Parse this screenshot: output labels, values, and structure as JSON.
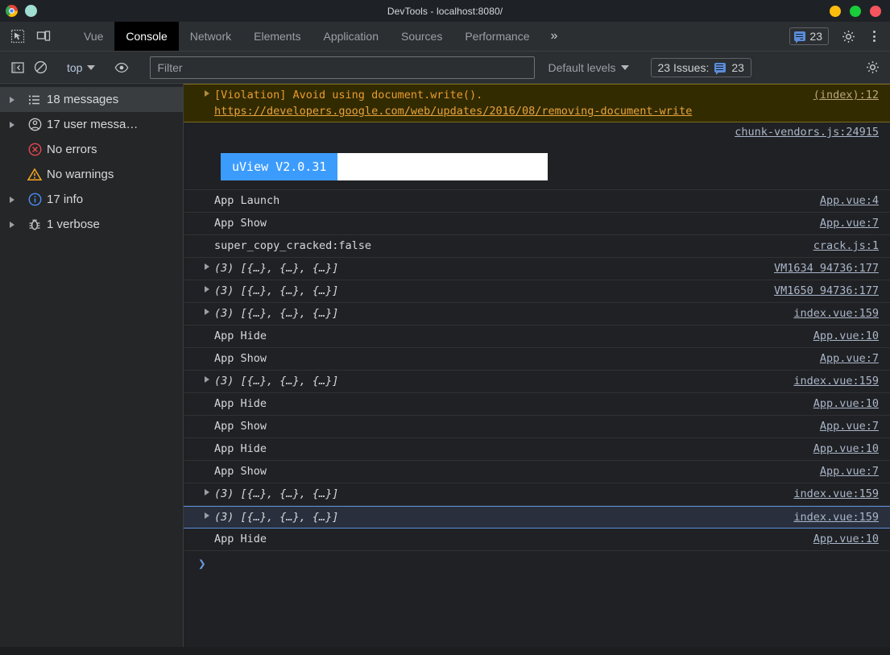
{
  "window": {
    "title": "DevTools - localhost:8080/",
    "logo_icon": "chrome-logo-icon",
    "profile_icon": "profile-avatar-icon",
    "minimize_label": "",
    "maximize_label": "",
    "close_label": ""
  },
  "tabbar": {
    "inspect_icon": "inspect-element-icon",
    "device_icon": "device-toolbar-icon",
    "tabs": [
      {
        "label": "Vue",
        "active": false
      },
      {
        "label": "Console",
        "active": true
      },
      {
        "label": "Network",
        "active": false
      },
      {
        "label": "Elements",
        "active": false
      },
      {
        "label": "Application",
        "active": false
      },
      {
        "label": "Sources",
        "active": false
      },
      {
        "label": "Performance",
        "active": false
      }
    ],
    "more_tabs_label": "»",
    "issues_count": "23",
    "issues_icon": "issues-bubble-icon",
    "settings_icon": "gear-icon",
    "menu_icon": "kebab-menu-icon"
  },
  "console_toolbar": {
    "sidebar_toggle_icon": "console-sidebar-toggle-icon",
    "clear_icon": "clear-console-icon",
    "context_label": "top",
    "context_caret_icon": "chevron-down-icon",
    "eye_icon": "live-expression-eye-icon",
    "filter_placeholder": "Filter",
    "filter_value": "",
    "levels_label": "Default levels",
    "levels_caret_icon": "chevron-down-icon",
    "issues_label": "23 Issues:",
    "issues_count": "23",
    "issues_icon": "issues-bubble-icon",
    "settings_icon": "gear-icon"
  },
  "sidebar": {
    "items": [
      {
        "label": "18 messages",
        "icon": "list-messages-icon",
        "expandable": true,
        "selected": true
      },
      {
        "label": "17 user messa…",
        "icon": "user-message-icon",
        "expandable": true,
        "selected": false
      },
      {
        "label": "No errors",
        "icon": "error-circle-icon",
        "expandable": false,
        "selected": false
      },
      {
        "label": "No warnings",
        "icon": "warning-triangle-icon",
        "expandable": false,
        "selected": false
      },
      {
        "label": "17 info",
        "icon": "info-circle-icon",
        "expandable": true,
        "selected": false
      },
      {
        "label": "1 verbose",
        "icon": "bug-verbose-icon",
        "expandable": true,
        "selected": false
      }
    ]
  },
  "console": {
    "violation": {
      "kind": "warning",
      "expand_icon": "disclosure-triangle-icon",
      "prefix": "[Violation] Avoid using document.write(). ",
      "link_text": "https://developers.google.com/web/updates/2016/08/removing-document-write",
      "source": "(index):12"
    },
    "uview": {
      "source": "chunk-vendors.js:24915",
      "badge_label": "uView V2.0.31",
      "badge_bg": "#3c9cfe",
      "badge_fg": "#ffffff",
      "panel_bg": "#ffffff"
    },
    "rows": [
      {
        "text": "App Launch",
        "source": "App.vue:4",
        "expandable": false,
        "italic": false,
        "selected": false
      },
      {
        "text": "App Show",
        "source": "App.vue:7",
        "expandable": false,
        "italic": false,
        "selected": false
      },
      {
        "text": "super_copy_cracked:false",
        "source": "crack.js:1",
        "expandable": false,
        "italic": false,
        "selected": false
      },
      {
        "text": "(3) [{…}, {…}, {…}]",
        "source": "VM1634 94736:177",
        "expandable": true,
        "italic": true,
        "selected": false
      },
      {
        "text": "(3) [{…}, {…}, {…}]",
        "source": "VM1650 94736:177",
        "expandable": true,
        "italic": true,
        "selected": false
      },
      {
        "text": "(3) [{…}, {…}, {…}]",
        "source": "index.vue:159",
        "expandable": true,
        "italic": true,
        "selected": false
      },
      {
        "text": "App Hide",
        "source": "App.vue:10",
        "expandable": false,
        "italic": false,
        "selected": false
      },
      {
        "text": "App Show",
        "source": "App.vue:7",
        "expandable": false,
        "italic": false,
        "selected": false
      },
      {
        "text": "(3) [{…}, {…}, {…}]",
        "source": "index.vue:159",
        "expandable": true,
        "italic": true,
        "selected": false
      },
      {
        "text": "App Hide",
        "source": "App.vue:10",
        "expandable": false,
        "italic": false,
        "selected": false
      },
      {
        "text": "App Show",
        "source": "App.vue:7",
        "expandable": false,
        "italic": false,
        "selected": false
      },
      {
        "text": "App Hide",
        "source": "App.vue:10",
        "expandable": false,
        "italic": false,
        "selected": false
      },
      {
        "text": "App Show",
        "source": "App.vue:7",
        "expandable": false,
        "italic": false,
        "selected": false
      },
      {
        "text": "(3) [{…}, {…}, {…}]",
        "source": "index.vue:159",
        "expandable": true,
        "italic": true,
        "selected": false
      },
      {
        "text": "(3) [{…}, {…}, {…}]",
        "source": "index.vue:159",
        "expandable": true,
        "italic": true,
        "selected": true
      },
      {
        "text": "App Hide",
        "source": "App.vue:10",
        "expandable": false,
        "italic": false,
        "selected": false
      }
    ],
    "prompt_chevron": "❯",
    "prompt_value": ""
  },
  "colors": {
    "accent_blue": "#5b8dd9",
    "warning_bg": "#332b00",
    "warning_fg": "#e89c31",
    "selected_row_bg": "#292f3c",
    "panel_bg": "#202124",
    "toolbar_bg": "#2b2f32",
    "sidebar_bg": "#242628"
  }
}
